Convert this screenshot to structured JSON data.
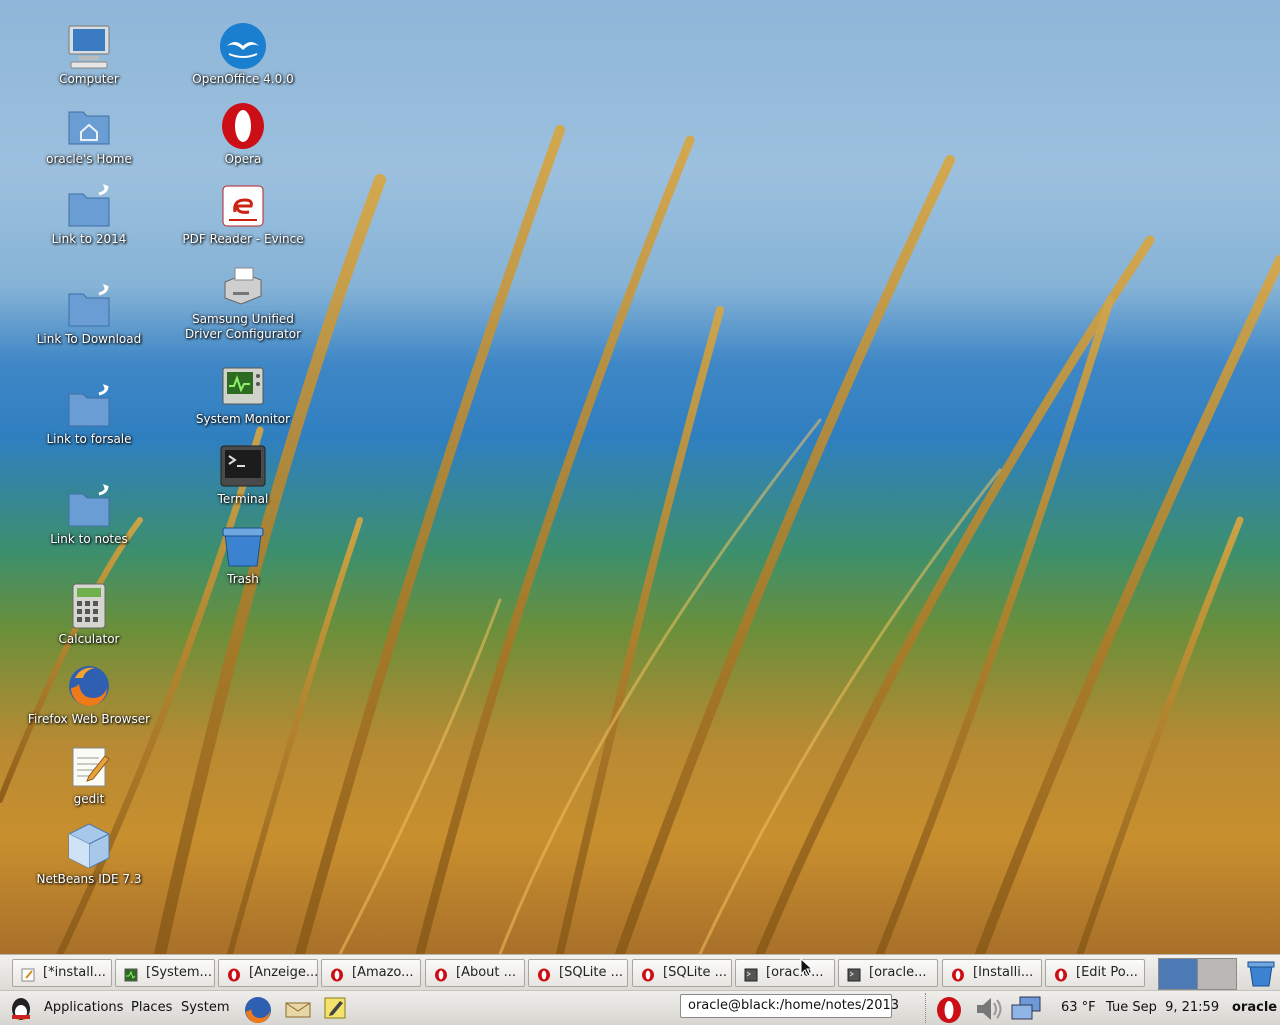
{
  "desktop_icons": {
    "computer": "Computer",
    "home": "oracle's Home",
    "link2014": "Link to 2014",
    "linkdownload": "Link To Download",
    "linkforsale": "Link to forsale",
    "linknotes": "Link to notes",
    "calculator": "Calculator",
    "firefox": "Firefox Web Browser",
    "gedit": "gedit",
    "netbeans": "NetBeans IDE 7.3",
    "openoffice": "OpenOffice 4.0.0",
    "opera": "Opera",
    "evince": "PDF Reader - Evince",
    "samsung1": "Samsung Unified",
    "samsung2": "Driver Configurator",
    "sysmon": "System Monitor",
    "terminal": "Terminal",
    "trash": "Trash"
  },
  "taskbar": {
    "tasks": [
      "[*install...",
      "[System...",
      "[Anzeige...",
      "[Amazo...",
      "[About ...",
      "[SQLite ...",
      "[SQLite ...",
      "[oracle...",
      "[oracle...",
      "[Installi...",
      "[Edit Po..."
    ]
  },
  "panel": {
    "applications": "Applications",
    "places": "Places",
    "system": "System",
    "tooltip": "oracle@black:/home/notes/2013",
    "temperature": "63 °F",
    "datetime": "Tue Sep  9, 21:59",
    "user": "oracle"
  },
  "colors": {
    "folder": "#5b8fc9",
    "opera_red": "#cc0f16",
    "panel": "#e4e2de"
  }
}
